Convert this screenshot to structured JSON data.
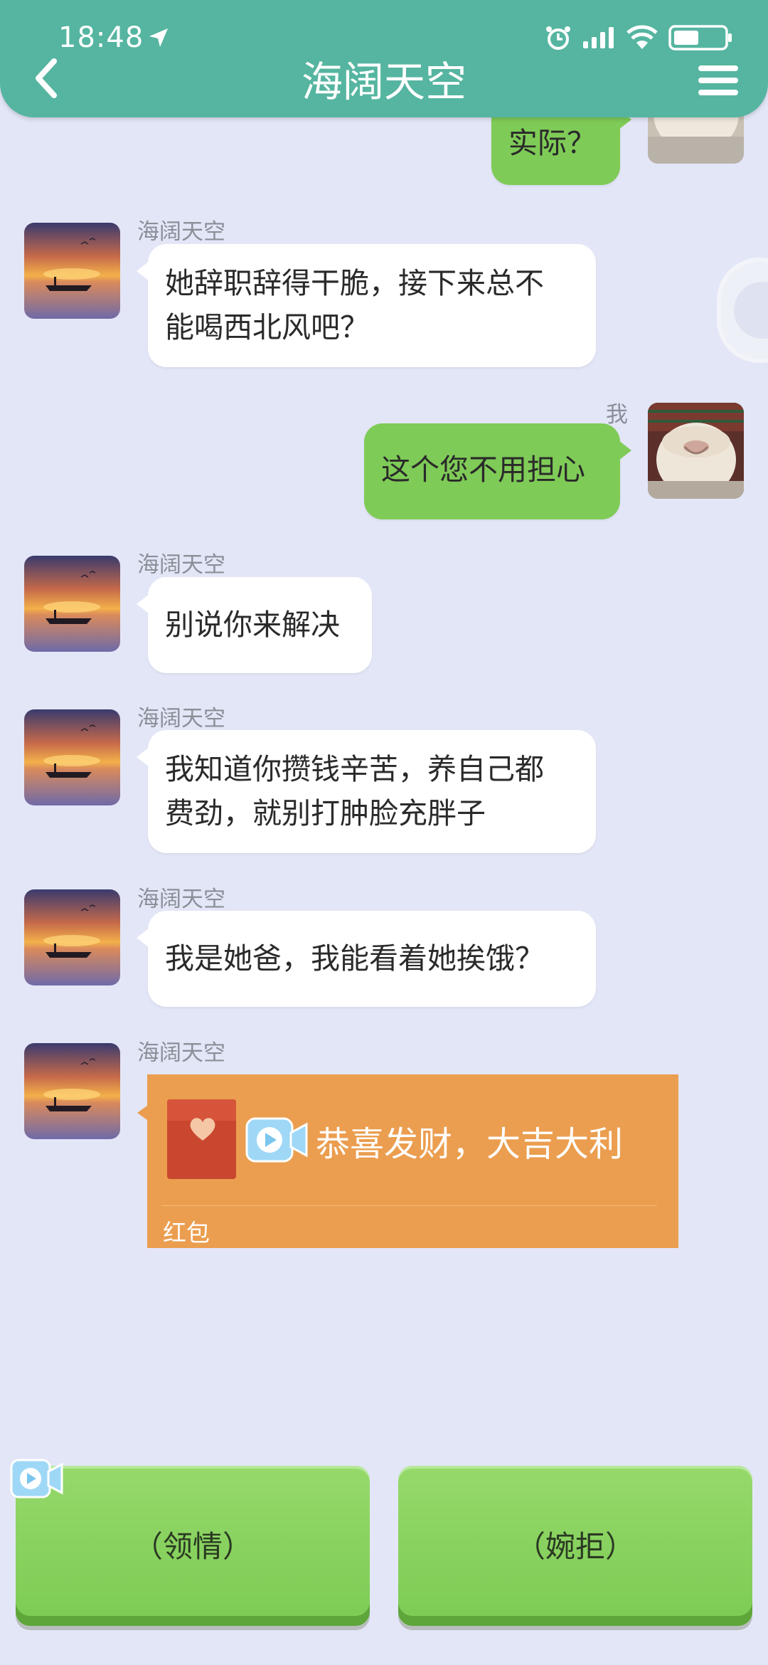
{
  "status_bar": {
    "time": "18:48"
  },
  "header": {
    "title": "海阔天空"
  },
  "messages": [
    {
      "side": "right",
      "sender": "",
      "text": "实际？"
    },
    {
      "side": "left",
      "sender": "海阔天空",
      "lines": [
        "她辞职辞得干脆，接下来总不",
        "能喝西北风吧？"
      ]
    },
    {
      "side": "right",
      "sender": "我",
      "text": "这个您不用担心"
    },
    {
      "side": "left",
      "sender": "海阔天空",
      "text": "别说你来解决"
    },
    {
      "side": "left",
      "sender": "海阔天空",
      "lines": [
        "我知道你攒钱辛苦，养自己都",
        "费劲，就别打肿脸充胖子"
      ]
    },
    {
      "side": "left",
      "sender": "海阔天空",
      "text": "我是她爸，我能看着她挨饿？"
    },
    {
      "side": "left",
      "sender": "海阔天空",
      "redpacket": {
        "text": "恭喜发财，大吉大利",
        "label": "红包"
      }
    }
  ],
  "choices": [
    {
      "label": "（领情）"
    },
    {
      "label": "（婉拒）"
    }
  ],
  "colors": {
    "header": "#55b5a0",
    "background": "#e3e6f7",
    "my_bubble": "#7fcb57",
    "other_bubble": "#ffffff",
    "red_packet": "#eb9e4f",
    "choice_button": "#8bd363"
  },
  "icons": [
    "location-arrow-icon",
    "alarm-icon",
    "signal-icon",
    "wifi-icon",
    "battery-icon",
    "back-icon",
    "menu-icon",
    "heart-icon",
    "video-icon"
  ]
}
